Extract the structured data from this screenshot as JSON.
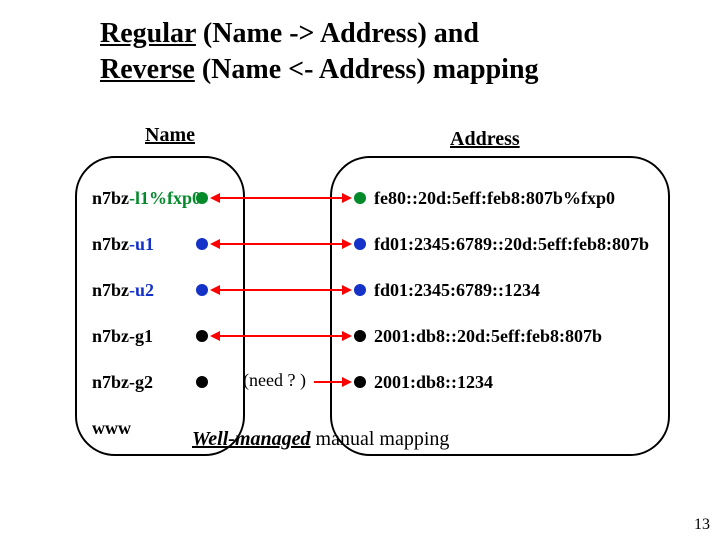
{
  "title": {
    "seg1": "Regular",
    "seg2": " (Name -> Address) and ",
    "seg3": "Reverse",
    "seg4": " (Name <- Address) mapping"
  },
  "headers": {
    "name": "Name",
    "address": "Address"
  },
  "rows": [
    {
      "prefix": "n7bz",
      "suffix": "-l1%fxp0",
      "suffix_color": "green",
      "addr": "fe80::20d:5eff:feb8:807b%fxp0",
      "dot_color": "green",
      "bidir": true
    },
    {
      "prefix": "n7bz",
      "suffix": "-u1",
      "suffix_color": "blue",
      "addr": "fd01:2345:6789::20d:5eff:feb8:807b",
      "dot_color": "blue",
      "bidir": true
    },
    {
      "prefix": "n7bz",
      "suffix": "-u2",
      "suffix_color": "blue",
      "addr": "fd01:2345:6789::1234",
      "dot_color": "blue",
      "bidir": true
    },
    {
      "prefix": "n7bz",
      "suffix": "-g1",
      "suffix_color": "black",
      "addr": "2001:db8::20d:5eff:feb8:807b",
      "dot_color": "black",
      "bidir": true
    },
    {
      "prefix": "n7bz",
      "suffix": "-g2",
      "suffix_color": "black",
      "addr": "2001:db8::1234",
      "dot_color": "black",
      "bidir": false
    }
  ],
  "need_label": "(need ? )",
  "www_label": "www",
  "caption": {
    "wm": "Well-managed",
    "rest": "  manual mapping"
  },
  "page_number": "13"
}
